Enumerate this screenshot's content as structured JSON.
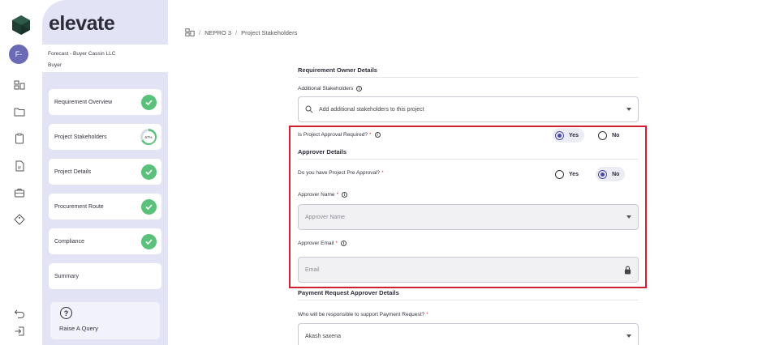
{
  "rail": {
    "logo_icon": "elevate-logo-icon",
    "avatar_text": "F-",
    "icons": [
      "dashboard-icon",
      "folder-icon",
      "clipboard-icon",
      "document-icon",
      "briefcase-icon",
      "tag-icon",
      "undo-icon",
      "logout-icon"
    ]
  },
  "sidebar": {
    "brand": "elevate",
    "account_line1": "Forecast - Buyer Cassin LLC",
    "account_line2": "Buyer",
    "steps": [
      {
        "label": "Requirement Overview",
        "status": "complete"
      },
      {
        "label": "Project Stakeholders",
        "status": "in-progress",
        "progress": "67%"
      },
      {
        "label": "Project Details",
        "status": "complete"
      },
      {
        "label": "Procurement Route",
        "status": "complete"
      },
      {
        "label": "Compliance",
        "status": "complete"
      },
      {
        "label": "Summary",
        "status": "none"
      }
    ],
    "query_label": "Raise A Query"
  },
  "breadcrumb": {
    "sep": "/",
    "project": "NEPRO 3",
    "page": "Project Stakeholders"
  },
  "form": {
    "owner_section": "Requirement Owner Details",
    "additional_label": "Additional Stakeholders",
    "additional_placeholder": "Add additional stakeholders to this project",
    "approval_required_label": "Is Project Approval Required?",
    "approval_required_value": "Yes",
    "yes": "Yes",
    "no": "No",
    "approver_section": "Approver Details",
    "pre_approval_label": "Do you have Project Pre Approval?",
    "pre_approval_value": "No",
    "approver_name_label": "Approver Name",
    "approver_name_placeholder": "Approver Name",
    "approver_email_label": "Approver Email",
    "approver_email_placeholder": "Email",
    "payment_section": "Payment Request Approver Details",
    "payment_label": "Who will be responsible to support Payment Request?",
    "payment_value": "Akash saxena",
    "required_mark": "*",
    "info_mark": "i"
  },
  "colors": {
    "accent": "#4a4aa8",
    "success": "#5ac17a",
    "highlight": "#d01f2e",
    "sidebar_bg": "#e2e3f5"
  }
}
